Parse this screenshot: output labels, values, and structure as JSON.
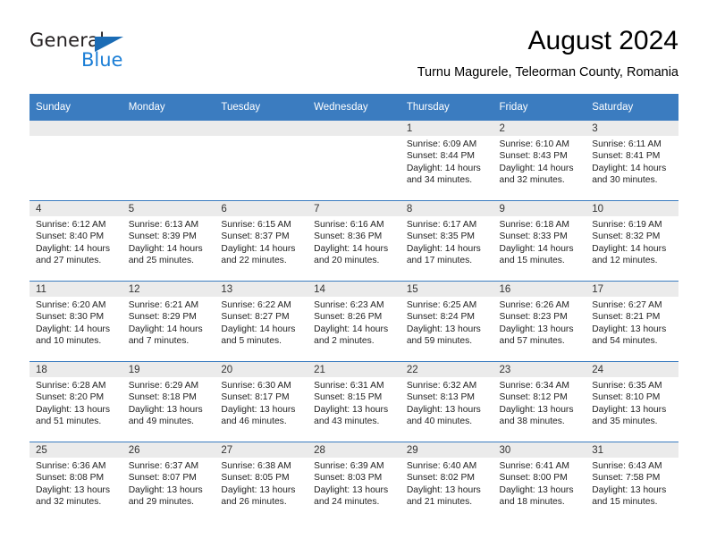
{
  "logo": {
    "text_top": "General",
    "text_bottom": "Blue",
    "triangle_icon": "triangle-icon",
    "color_dark": "#231f20",
    "color_blue": "#1b7ed6"
  },
  "header": {
    "title": "August 2024",
    "subtitle": "Turnu Magurele, Teleorman County, Romania"
  },
  "theme": {
    "header_blue": "#3b7cc0",
    "daynum_band": "#ebebeb"
  },
  "weekdays": [
    "Sunday",
    "Monday",
    "Tuesday",
    "Wednesday",
    "Thursday",
    "Friday",
    "Saturday"
  ],
  "labels": {
    "sunrise_prefix": "Sunrise: ",
    "sunset_prefix": "Sunset: ",
    "daylight_prefix": "Daylight: "
  },
  "weeks": [
    [
      {
        "day": "",
        "empty": true
      },
      {
        "day": "",
        "empty": true
      },
      {
        "day": "",
        "empty": true
      },
      {
        "day": "",
        "empty": true
      },
      {
        "day": "1",
        "sunrise": "Sunrise: 6:09 AM",
        "sunset": "Sunset: 8:44 PM",
        "daylight": "Daylight: 14 hours and 34 minutes."
      },
      {
        "day": "2",
        "sunrise": "Sunrise: 6:10 AM",
        "sunset": "Sunset: 8:43 PM",
        "daylight": "Daylight: 14 hours and 32 minutes."
      },
      {
        "day": "3",
        "sunrise": "Sunrise: 6:11 AM",
        "sunset": "Sunset: 8:41 PM",
        "daylight": "Daylight: 14 hours and 30 minutes."
      }
    ],
    [
      {
        "day": "4",
        "sunrise": "Sunrise: 6:12 AM",
        "sunset": "Sunset: 8:40 PM",
        "daylight": "Daylight: 14 hours and 27 minutes."
      },
      {
        "day": "5",
        "sunrise": "Sunrise: 6:13 AM",
        "sunset": "Sunset: 8:39 PM",
        "daylight": "Daylight: 14 hours and 25 minutes."
      },
      {
        "day": "6",
        "sunrise": "Sunrise: 6:15 AM",
        "sunset": "Sunset: 8:37 PM",
        "daylight": "Daylight: 14 hours and 22 minutes."
      },
      {
        "day": "7",
        "sunrise": "Sunrise: 6:16 AM",
        "sunset": "Sunset: 8:36 PM",
        "daylight": "Daylight: 14 hours and 20 minutes."
      },
      {
        "day": "8",
        "sunrise": "Sunrise: 6:17 AM",
        "sunset": "Sunset: 8:35 PM",
        "daylight": "Daylight: 14 hours and 17 minutes."
      },
      {
        "day": "9",
        "sunrise": "Sunrise: 6:18 AM",
        "sunset": "Sunset: 8:33 PM",
        "daylight": "Daylight: 14 hours and 15 minutes."
      },
      {
        "day": "10",
        "sunrise": "Sunrise: 6:19 AM",
        "sunset": "Sunset: 8:32 PM",
        "daylight": "Daylight: 14 hours and 12 minutes."
      }
    ],
    [
      {
        "day": "11",
        "sunrise": "Sunrise: 6:20 AM",
        "sunset": "Sunset: 8:30 PM",
        "daylight": "Daylight: 14 hours and 10 minutes."
      },
      {
        "day": "12",
        "sunrise": "Sunrise: 6:21 AM",
        "sunset": "Sunset: 8:29 PM",
        "daylight": "Daylight: 14 hours and 7 minutes."
      },
      {
        "day": "13",
        "sunrise": "Sunrise: 6:22 AM",
        "sunset": "Sunset: 8:27 PM",
        "daylight": "Daylight: 14 hours and 5 minutes."
      },
      {
        "day": "14",
        "sunrise": "Sunrise: 6:23 AM",
        "sunset": "Sunset: 8:26 PM",
        "daylight": "Daylight: 14 hours and 2 minutes."
      },
      {
        "day": "15",
        "sunrise": "Sunrise: 6:25 AM",
        "sunset": "Sunset: 8:24 PM",
        "daylight": "Daylight: 13 hours and 59 minutes."
      },
      {
        "day": "16",
        "sunrise": "Sunrise: 6:26 AM",
        "sunset": "Sunset: 8:23 PM",
        "daylight": "Daylight: 13 hours and 57 minutes."
      },
      {
        "day": "17",
        "sunrise": "Sunrise: 6:27 AM",
        "sunset": "Sunset: 8:21 PM",
        "daylight": "Daylight: 13 hours and 54 minutes."
      }
    ],
    [
      {
        "day": "18",
        "sunrise": "Sunrise: 6:28 AM",
        "sunset": "Sunset: 8:20 PM",
        "daylight": "Daylight: 13 hours and 51 minutes."
      },
      {
        "day": "19",
        "sunrise": "Sunrise: 6:29 AM",
        "sunset": "Sunset: 8:18 PM",
        "daylight": "Daylight: 13 hours and 49 minutes."
      },
      {
        "day": "20",
        "sunrise": "Sunrise: 6:30 AM",
        "sunset": "Sunset: 8:17 PM",
        "daylight": "Daylight: 13 hours and 46 minutes."
      },
      {
        "day": "21",
        "sunrise": "Sunrise: 6:31 AM",
        "sunset": "Sunset: 8:15 PM",
        "daylight": "Daylight: 13 hours and 43 minutes."
      },
      {
        "day": "22",
        "sunrise": "Sunrise: 6:32 AM",
        "sunset": "Sunset: 8:13 PM",
        "daylight": "Daylight: 13 hours and 40 minutes."
      },
      {
        "day": "23",
        "sunrise": "Sunrise: 6:34 AM",
        "sunset": "Sunset: 8:12 PM",
        "daylight": "Daylight: 13 hours and 38 minutes."
      },
      {
        "day": "24",
        "sunrise": "Sunrise: 6:35 AM",
        "sunset": "Sunset: 8:10 PM",
        "daylight": "Daylight: 13 hours and 35 minutes."
      }
    ],
    [
      {
        "day": "25",
        "sunrise": "Sunrise: 6:36 AM",
        "sunset": "Sunset: 8:08 PM",
        "daylight": "Daylight: 13 hours and 32 minutes."
      },
      {
        "day": "26",
        "sunrise": "Sunrise: 6:37 AM",
        "sunset": "Sunset: 8:07 PM",
        "daylight": "Daylight: 13 hours and 29 minutes."
      },
      {
        "day": "27",
        "sunrise": "Sunrise: 6:38 AM",
        "sunset": "Sunset: 8:05 PM",
        "daylight": "Daylight: 13 hours and 26 minutes."
      },
      {
        "day": "28",
        "sunrise": "Sunrise: 6:39 AM",
        "sunset": "Sunset: 8:03 PM",
        "daylight": "Daylight: 13 hours and 24 minutes."
      },
      {
        "day": "29",
        "sunrise": "Sunrise: 6:40 AM",
        "sunset": "Sunset: 8:02 PM",
        "daylight": "Daylight: 13 hours and 21 minutes."
      },
      {
        "day": "30",
        "sunrise": "Sunrise: 6:41 AM",
        "sunset": "Sunset: 8:00 PM",
        "daylight": "Daylight: 13 hours and 18 minutes."
      },
      {
        "day": "31",
        "sunrise": "Sunrise: 6:43 AM",
        "sunset": "Sunset: 7:58 PM",
        "daylight": "Daylight: 13 hours and 15 minutes."
      }
    ]
  ]
}
